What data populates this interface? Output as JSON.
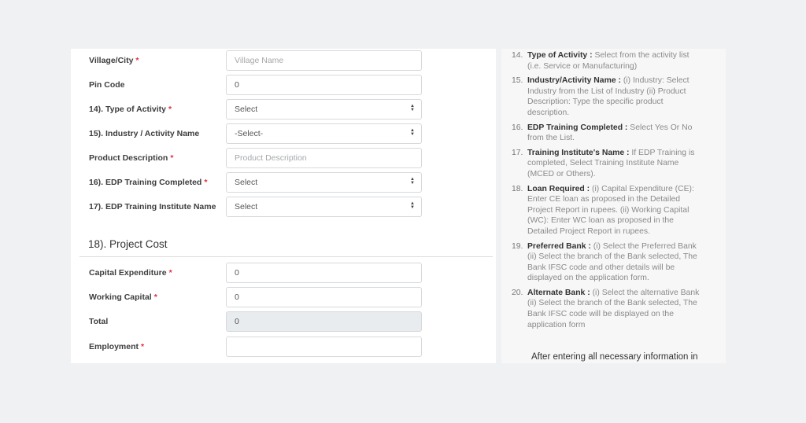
{
  "form": {
    "rows": [
      {
        "label": "Village/City",
        "required": true,
        "type": "input",
        "value": "",
        "placeholder": "Village Name"
      },
      {
        "label": "Pin Code",
        "required": false,
        "type": "input",
        "value": "0",
        "placeholder": ""
      },
      {
        "label": "14). Type of Activity",
        "required": true,
        "type": "select",
        "value": "Select"
      },
      {
        "label": "15). Industry / Activity Name",
        "required": false,
        "type": "select",
        "value": "-Select-"
      },
      {
        "label": "Product Description",
        "required": true,
        "type": "input",
        "value": "",
        "placeholder": "Product Description"
      },
      {
        "label": "16). EDP Training Completed",
        "required": true,
        "type": "select",
        "value": "Select"
      },
      {
        "label": "17). EDP Training Institute Name",
        "required": false,
        "type": "select",
        "value": "Select"
      }
    ],
    "section_heading": "18). Project Cost",
    "cost_rows": [
      {
        "label": "Capital Expenditure",
        "required": true,
        "value": "0",
        "disabled": false
      },
      {
        "label": "Working Capital",
        "required": true,
        "value": "0",
        "disabled": false
      },
      {
        "label": "Total",
        "required": false,
        "value": "0",
        "disabled": true
      },
      {
        "label": "Employment",
        "required": true,
        "value": "",
        "disabled": false
      }
    ],
    "required_mark": "*",
    "select_arrow_icon": "sort-arrows-icon"
  },
  "help": {
    "items": [
      {
        "num": "14.",
        "title": "Type of Activity :",
        "text": " Select from the activity list (i.e. Service or Manufacturing)"
      },
      {
        "num": "15.",
        "title": "Industry/Activity Name :",
        "text": " (i) Industry: Select Industry from the List of Industry (ii) Product Description: Type the specific product description."
      },
      {
        "num": "16.",
        "title": "EDP Training Completed :",
        "text": " Select Yes Or No from the List."
      },
      {
        "num": "17.",
        "title": "Training Institute's Name :",
        "text": " If EDP Training is completed, Select Training Institute Name (MCED or Others)."
      },
      {
        "num": "18.",
        "title": "Loan Required :",
        "text": " (i) Capital Expenditure (CE): Enter CE loan as proposed in the Detailed Project Report in rupees. (ii) Working Capital (WC): Enter WC loan as proposed in the Detailed Project Report in rupees."
      },
      {
        "num": "19.",
        "title": "Preferred Bank :",
        "text": " (i) Select the Preferred Bank (ii) Select the branch of the Bank selected, The Bank IFSC code and other details will be displayed on the application form."
      },
      {
        "num": "20.",
        "title": "Alternate Bank :",
        "text": " (i) Select the alternative Bank (ii) Select the branch of the Bank selected, The Bank IFSC code will be displayed on the application form"
      }
    ],
    "after_text": "After entering all necessary information in"
  }
}
